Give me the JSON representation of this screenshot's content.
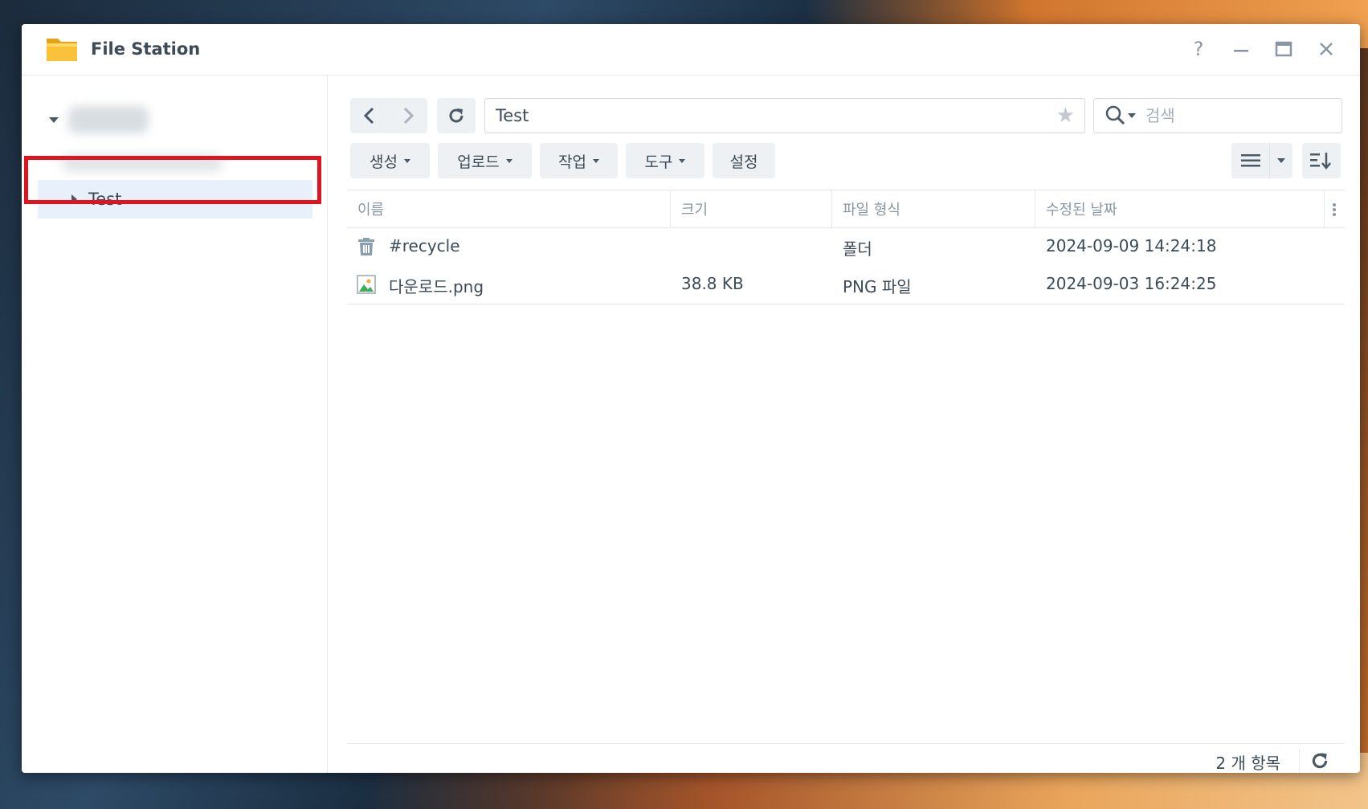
{
  "window": {
    "title": "File Station"
  },
  "titlebar_buttons": {
    "help": "?",
    "minimize": "—",
    "maximize": "▭",
    "close": "✕"
  },
  "sidebar": {
    "tree_item": "Test"
  },
  "path": {
    "current": "Test"
  },
  "search": {
    "placeholder": "검색"
  },
  "toolbar": {
    "create": "생성",
    "upload": "업로드",
    "action": "작업",
    "tools": "도구",
    "settings": "설정"
  },
  "table": {
    "columns": [
      "이름",
      "크기",
      "파일 형식",
      "수정된 날짜"
    ],
    "rows": [
      {
        "name": "#recycle",
        "size": "",
        "type": "폴더",
        "modified": "2024-09-09 14:24:18",
        "icon": "trash-icon"
      },
      {
        "name": "다운로드.png",
        "size": "38.8 KB",
        "type": "PNG 파일",
        "modified": "2024-09-03 16:24:25",
        "icon": "image-file-icon"
      }
    ]
  },
  "footer": {
    "count": "2 개 항목"
  },
  "colors": {
    "selection": "#e8f1fb",
    "highlight_border": "#e0141e",
    "button_bg": "#eef1f4"
  }
}
